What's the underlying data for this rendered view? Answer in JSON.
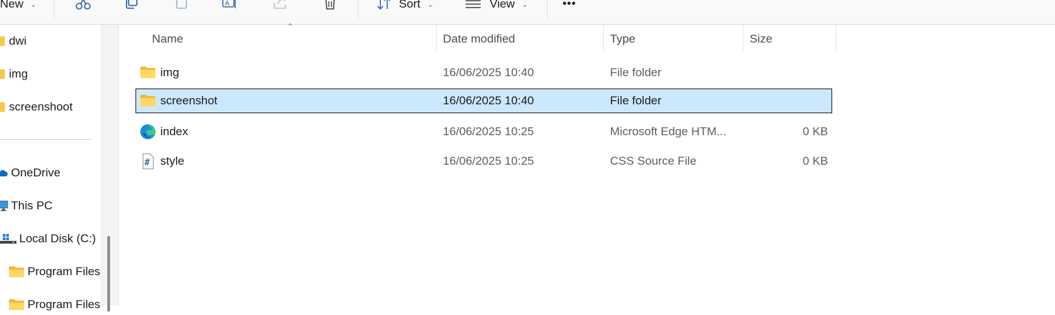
{
  "toolbar": {
    "new_label": "New",
    "sort_label": "Sort",
    "view_label": "View",
    "more_label": "•••"
  },
  "nav": {
    "items": [
      {
        "label": "dwi",
        "icon": "folder-icon"
      },
      {
        "label": "img",
        "icon": "folder-icon"
      },
      {
        "label": "screenshoot",
        "icon": "folder-icon"
      },
      {
        "label": "OneDrive",
        "icon": "cloud-icon"
      },
      {
        "label": "This PC",
        "icon": "monitor-icon"
      },
      {
        "label": "Local Disk (C:)",
        "icon": "drive-icon"
      },
      {
        "label": "Program Files",
        "icon": "folder-icon"
      },
      {
        "label": "Program Files",
        "icon": "folder-icon"
      }
    ]
  },
  "columns": {
    "name": "Name",
    "date": "Date modified",
    "type": "Type",
    "size": "Size"
  },
  "files": [
    {
      "name": "img",
      "date": "16/06/2025 10:40",
      "type": "File folder",
      "size": "",
      "icon": "folder-icon",
      "selected": false
    },
    {
      "name": "screenshot",
      "date": "16/06/2025 10:40",
      "type": "File folder",
      "size": "",
      "icon": "folder-icon",
      "selected": true
    },
    {
      "name": "index",
      "date": "16/06/2025 10:25",
      "type": "Microsoft Edge HTM...",
      "size": "0 KB",
      "icon": "edge-icon",
      "selected": false
    },
    {
      "name": "style",
      "date": "16/06/2025 10:25",
      "type": "CSS Source File",
      "size": "0 KB",
      "icon": "css-file-icon",
      "selected": false
    }
  ],
  "colors": {
    "selection": "#cce8ff",
    "folder": "#f7c948",
    "accent": "#0067c0"
  }
}
